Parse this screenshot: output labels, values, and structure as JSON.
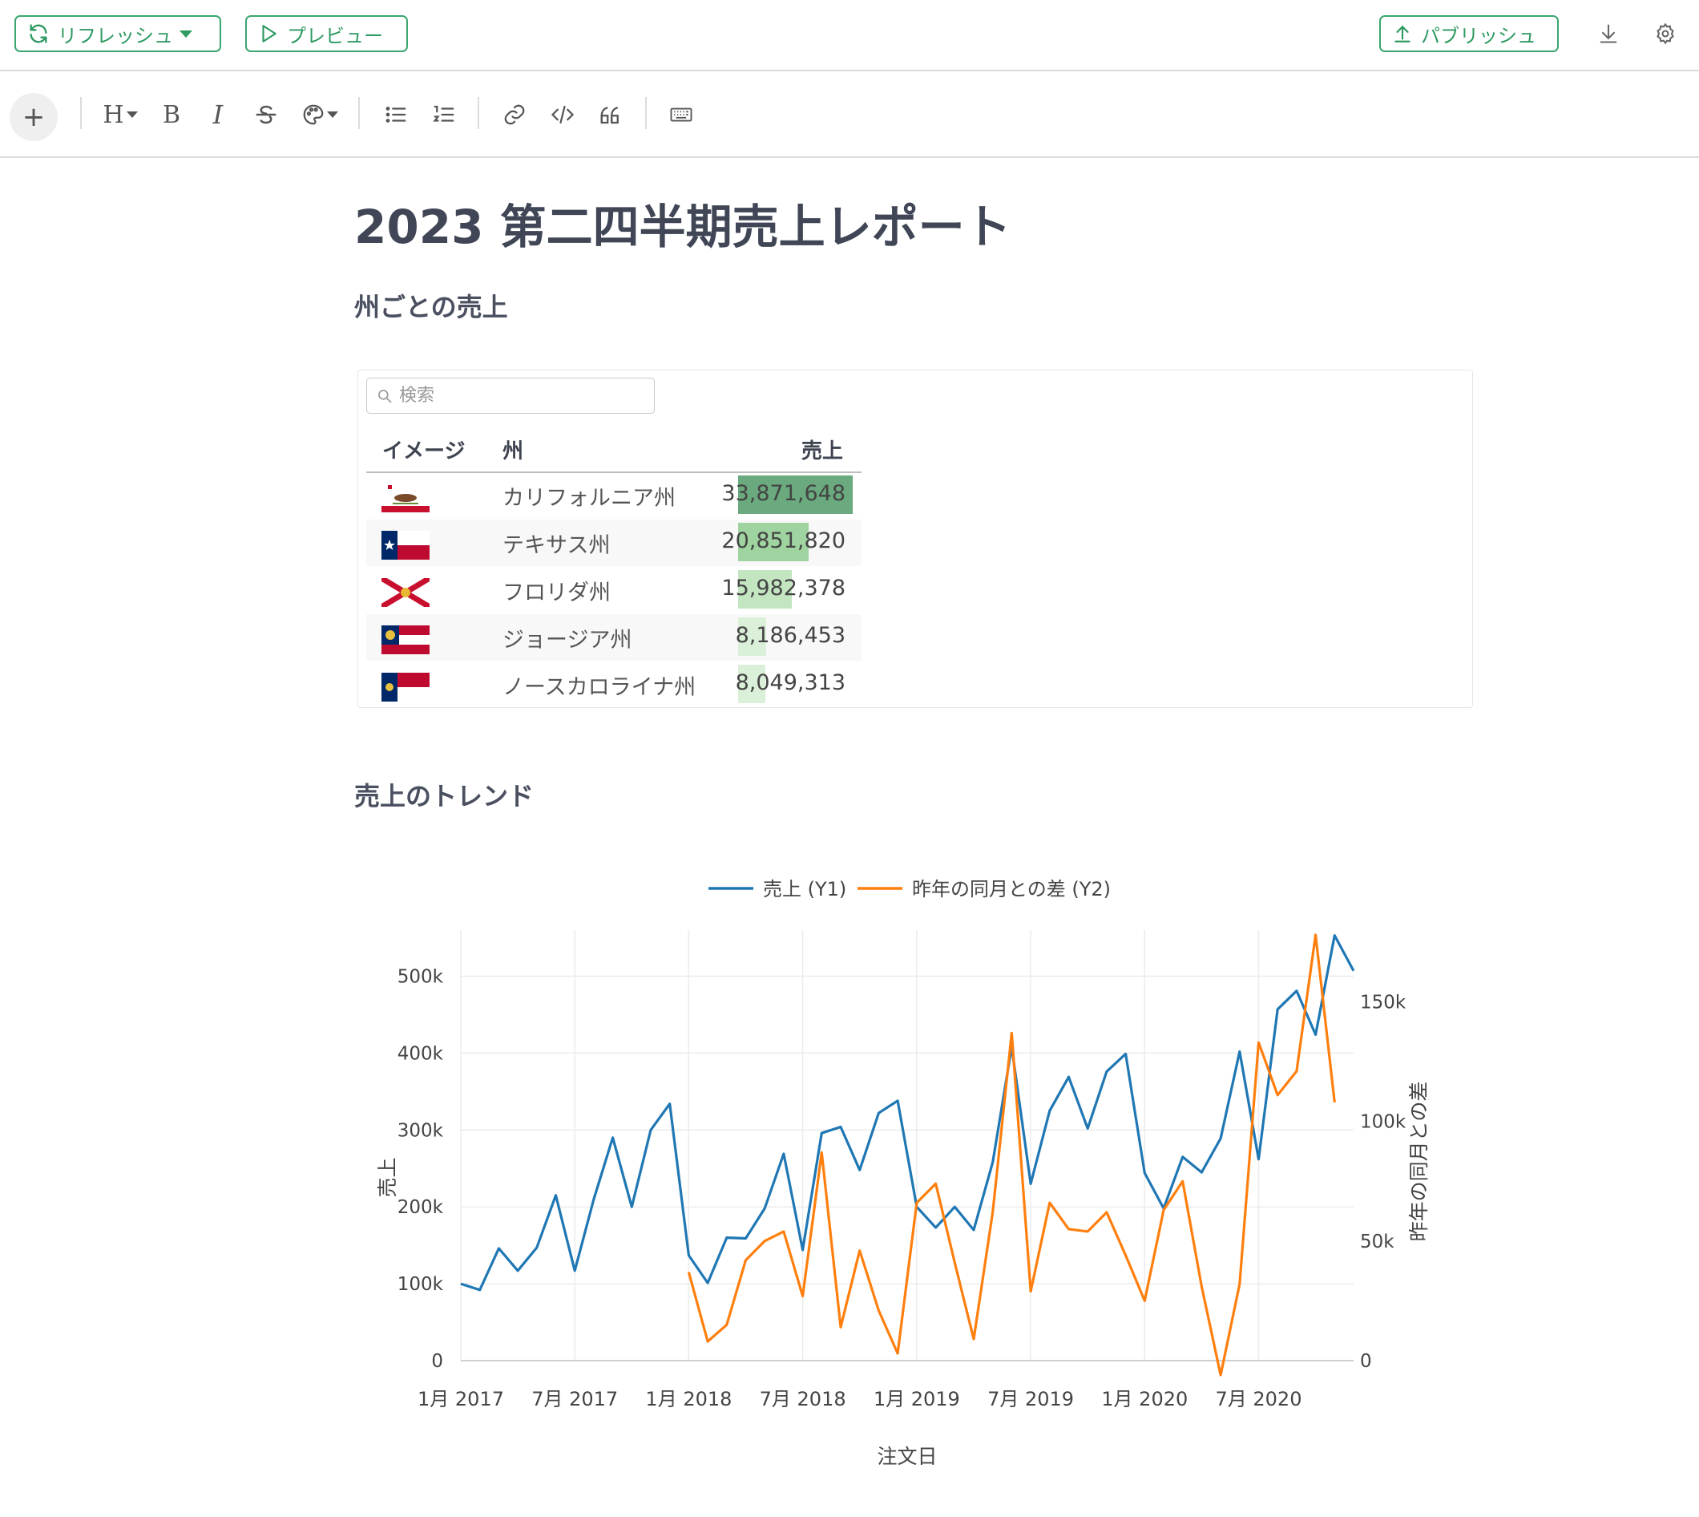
{
  "header": {
    "refresh_label": "リフレッシュ",
    "preview_label": "プレビュー",
    "publish_label": "パブリッシュ"
  },
  "toolbar": {
    "plus": "+",
    "heading": "H",
    "bold": "B",
    "italic": "I"
  },
  "document": {
    "title": "2023 第二四半期売上レポート",
    "section1": "州ごとの売上",
    "section2": "売上のトレンド"
  },
  "table": {
    "search_placeholder": "検索",
    "columns": [
      "イメージ",
      "州",
      "売上"
    ],
    "rows": [
      {
        "flag": "california-flag",
        "state": "カリフォルニア州",
        "sales": "33,871,648",
        "value": 33871648
      },
      {
        "flag": "texas-flag",
        "state": "テキサス州",
        "sales": "20,851,820",
        "value": 20851820
      },
      {
        "flag": "florida-flag",
        "state": "フロリダ州",
        "sales": "15,982,378",
        "value": 15982378
      },
      {
        "flag": "georgia-flag",
        "state": "ジョージア州",
        "sales": "8,186,453",
        "value": 8186453
      },
      {
        "flag": "north-carolina-flag",
        "state": "ノースカロライナ州",
        "sales": "8,049,313",
        "value": 8049313
      }
    ],
    "bar_colors": [
      "#6aaa7e",
      "#9fd39f",
      "#c3e6c1",
      "#daf0d8",
      "#dbf0d8"
    ]
  },
  "chart_data": {
    "type": "line",
    "xlabel": "注文日",
    "ylabel": "売上",
    "y2label": "昨年の同月との差",
    "legend_position": "top-center",
    "grid": true,
    "x_ticks": [
      "1月 2017",
      "7月 2017",
      "1月 2018",
      "7月 2018",
      "1月 2019",
      "7月 2019",
      "1月 2020",
      "7月 2020"
    ],
    "y_ticks": [
      "0",
      "100k",
      "200k",
      "300k",
      "400k",
      "500k"
    ],
    "y2_ticks": [
      "0",
      "50k",
      "100k",
      "150k"
    ],
    "ylim": [
      0,
      560000
    ],
    "y2lim": [
      0,
      180000
    ],
    "x": [
      "2017-01",
      "2017-02",
      "2017-03",
      "2017-04",
      "2017-05",
      "2017-06",
      "2017-07",
      "2017-08",
      "2017-09",
      "2017-10",
      "2017-11",
      "2017-12",
      "2018-01",
      "2018-02",
      "2018-03",
      "2018-04",
      "2018-05",
      "2018-06",
      "2018-07",
      "2018-08",
      "2018-09",
      "2018-10",
      "2018-11",
      "2018-12",
      "2019-01",
      "2019-02",
      "2019-03",
      "2019-04",
      "2019-05",
      "2019-06",
      "2019-07",
      "2019-08",
      "2019-09",
      "2019-10",
      "2019-11",
      "2019-12",
      "2020-01",
      "2020-02",
      "2020-03",
      "2020-04",
      "2020-05",
      "2020-06",
      "2020-07",
      "2020-08",
      "2020-09",
      "2020-10",
      "2020-11",
      "2020-12"
    ],
    "series": [
      {
        "name": "売上 (Y1)",
        "axis": "y",
        "color": "#1f77b4",
        "values": [
          100000,
          92000,
          146000,
          117000,
          147000,
          215000,
          117000,
          210000,
          290000,
          200000,
          300000,
          334000,
          137000,
          101000,
          160000,
          159000,
          198000,
          269000,
          144000,
          296000,
          304000,
          248000,
          322000,
          338000,
          200000,
          173000,
          200000,
          170000,
          258000,
          408000,
          230000,
          325000,
          369000,
          302000,
          376000,
          399000,
          244000,
          198000,
          265000,
          245000,
          289000,
          402000,
          262000,
          457000,
          481000,
          424000,
          553000,
          507000
        ]
      },
      {
        "name": "昨年の同月との差 (Y2)",
        "axis": "y2",
        "color": "#ff7f0e",
        "values": [
          null,
          null,
          null,
          null,
          null,
          null,
          null,
          null,
          null,
          null,
          null,
          null,
          37000,
          8000,
          15000,
          42000,
          50000,
          54000,
          27000,
          87000,
          14000,
          46000,
          21000,
          3000,
          66000,
          74000,
          41000,
          9000,
          62000,
          137000,
          29000,
          66000,
          55000,
          54000,
          62000,
          44000,
          25000,
          63000,
          75000,
          31000,
          -6000,
          32000,
          133000,
          111000,
          121000,
          178000,
          108000
        ]
      }
    ]
  }
}
